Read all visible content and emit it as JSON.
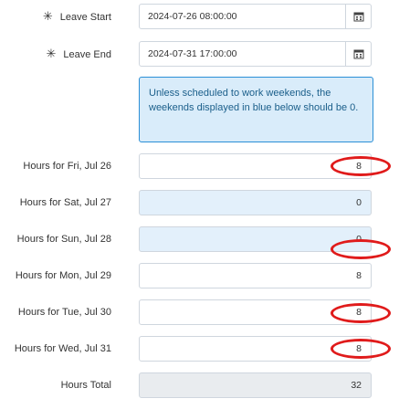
{
  "leave_start": {
    "label": "Leave Start",
    "value": "2024-07-26 08:00:00",
    "icon": "calendar-icon"
  },
  "leave_end": {
    "label": "Leave End",
    "value": "2024-07-31 17:00:00",
    "icon": "calendar-icon"
  },
  "weekend_note": "Unless scheduled to work weekends, the weekends displayed in blue below should be 0.",
  "hours": [
    {
      "label": "Hours for Fri, Jul 26",
      "value": "8",
      "weekend": false,
      "highlighted": true
    },
    {
      "label": "Hours for Sat, Jul 27",
      "value": "0",
      "weekend": true,
      "highlighted": false
    },
    {
      "label": "Hours for Sun, Jul 28",
      "value": "0",
      "weekend": true,
      "highlighted": false
    },
    {
      "label": "Hours for Mon, Jul 29",
      "value": "8",
      "weekend": false,
      "highlighted": true
    },
    {
      "label": "Hours for Tue, Jul 30",
      "value": "8",
      "weekend": false,
      "highlighted": true
    },
    {
      "label": "Hours for Wed, Jul 31",
      "value": "8",
      "weekend": false,
      "highlighted": true
    }
  ],
  "total": {
    "label": "Hours Total",
    "value": "32"
  },
  "colors": {
    "highlight": "#e01b1b",
    "weekend_fill": "#e3f0fb",
    "note_border": "#2b8fd6"
  }
}
